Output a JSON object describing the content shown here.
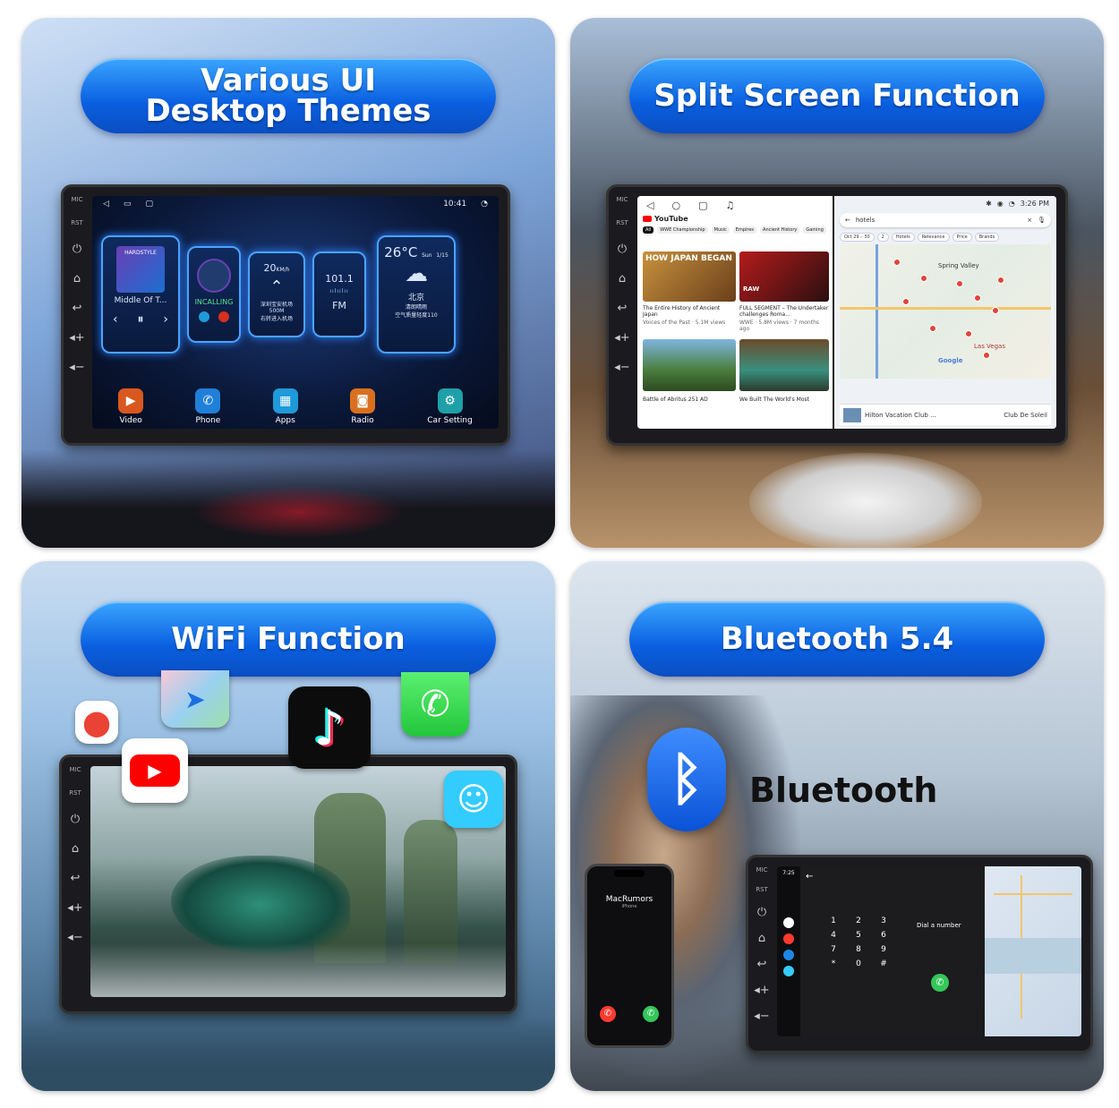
{
  "panels": {
    "themes": {
      "title_line1": "Various UI",
      "title_line2": "Desktop Themes",
      "status_time": "10:41",
      "side_labels": [
        "MIC",
        "RST"
      ],
      "music_title": "Middle Of T...",
      "album_label": "HARDSTYLE",
      "call_label": "INCALLING",
      "speed": "20",
      "speed_unit": "KM/h",
      "nav_text": "深圳宝安机场",
      "nav_dist": "500M",
      "nav_sub": "右转进入机场",
      "fm_freq": "101.1",
      "fm_label": "FM",
      "weather_temp": "26°C",
      "weather_day": "Sun",
      "weather_date": "1/15",
      "weather_city": "北京",
      "weather_line1": "清朗晴雨",
      "weather_line2": "空气质量轻度110",
      "dock": [
        {
          "label": "Video",
          "color": "#d9581f",
          "icon": "video-icon"
        },
        {
          "label": "Phone",
          "color": "#1f7fd9",
          "icon": "phone-icon"
        },
        {
          "label": "Apps",
          "color": "#1f9ad9",
          "icon": "apps-icon"
        },
        {
          "label": "Radio",
          "color": "#d9701f",
          "icon": "radio-icon"
        },
        {
          "label": "Car Setting",
          "color": "#1fa0a8",
          "icon": "settings-icon"
        }
      ]
    },
    "split": {
      "title": "Split Screen Function",
      "status_time": "3:26 PM",
      "yt_brand": "YouTube",
      "yt_chips": [
        "All",
        "WWE Championship",
        "Music",
        "Empires",
        "Ancient History",
        "Gaming"
      ],
      "yt_video1_title": "HOW JAPAN BEGAN",
      "yt_video1_caption": "The Entire History of Ancient Japan",
      "yt_video1_meta": "Voices of the Past · 5.1M views",
      "yt_video2_title": "RAW",
      "yt_video2_caption": "FULL SEGMENT – The Undertaker challenges Roma...",
      "yt_video2_meta": "WWE · 5.8M views · 7 months ago",
      "yt_video3_caption": "Battle of Abritus 251 AD",
      "yt_video4_caption": "We Built The World's Most",
      "maps_search": "hotels",
      "maps_filters": [
        "Oct 29 – 30",
        "2",
        "Hotels",
        "Relevance",
        "Price",
        "Brands"
      ],
      "maps_place1": "Spring Valley",
      "maps_place2": "Las Vegas",
      "maps_result": "Hilton Vacation Club ...",
      "maps_result2": "Club De Soleil",
      "maps_brand": "Google"
    },
    "wifi": {
      "title": "WiFi Function"
    },
    "bluetooth": {
      "title": "Bluetooth 5.4",
      "bt_label": "Bluetooth",
      "phone_caller": "MacRumors",
      "phone_sub": "iPhone",
      "car_time": "7:25",
      "dial_label": "Dial a number",
      "keypad": [
        "1",
        "2",
        "3",
        "4",
        "5",
        "6",
        "7",
        "8",
        "9",
        "*",
        "0",
        "#"
      ]
    }
  },
  "colors": {
    "pill_blue": "#0a5fe0",
    "accept_green": "#34c759",
    "decline_red": "#ff3b30"
  }
}
